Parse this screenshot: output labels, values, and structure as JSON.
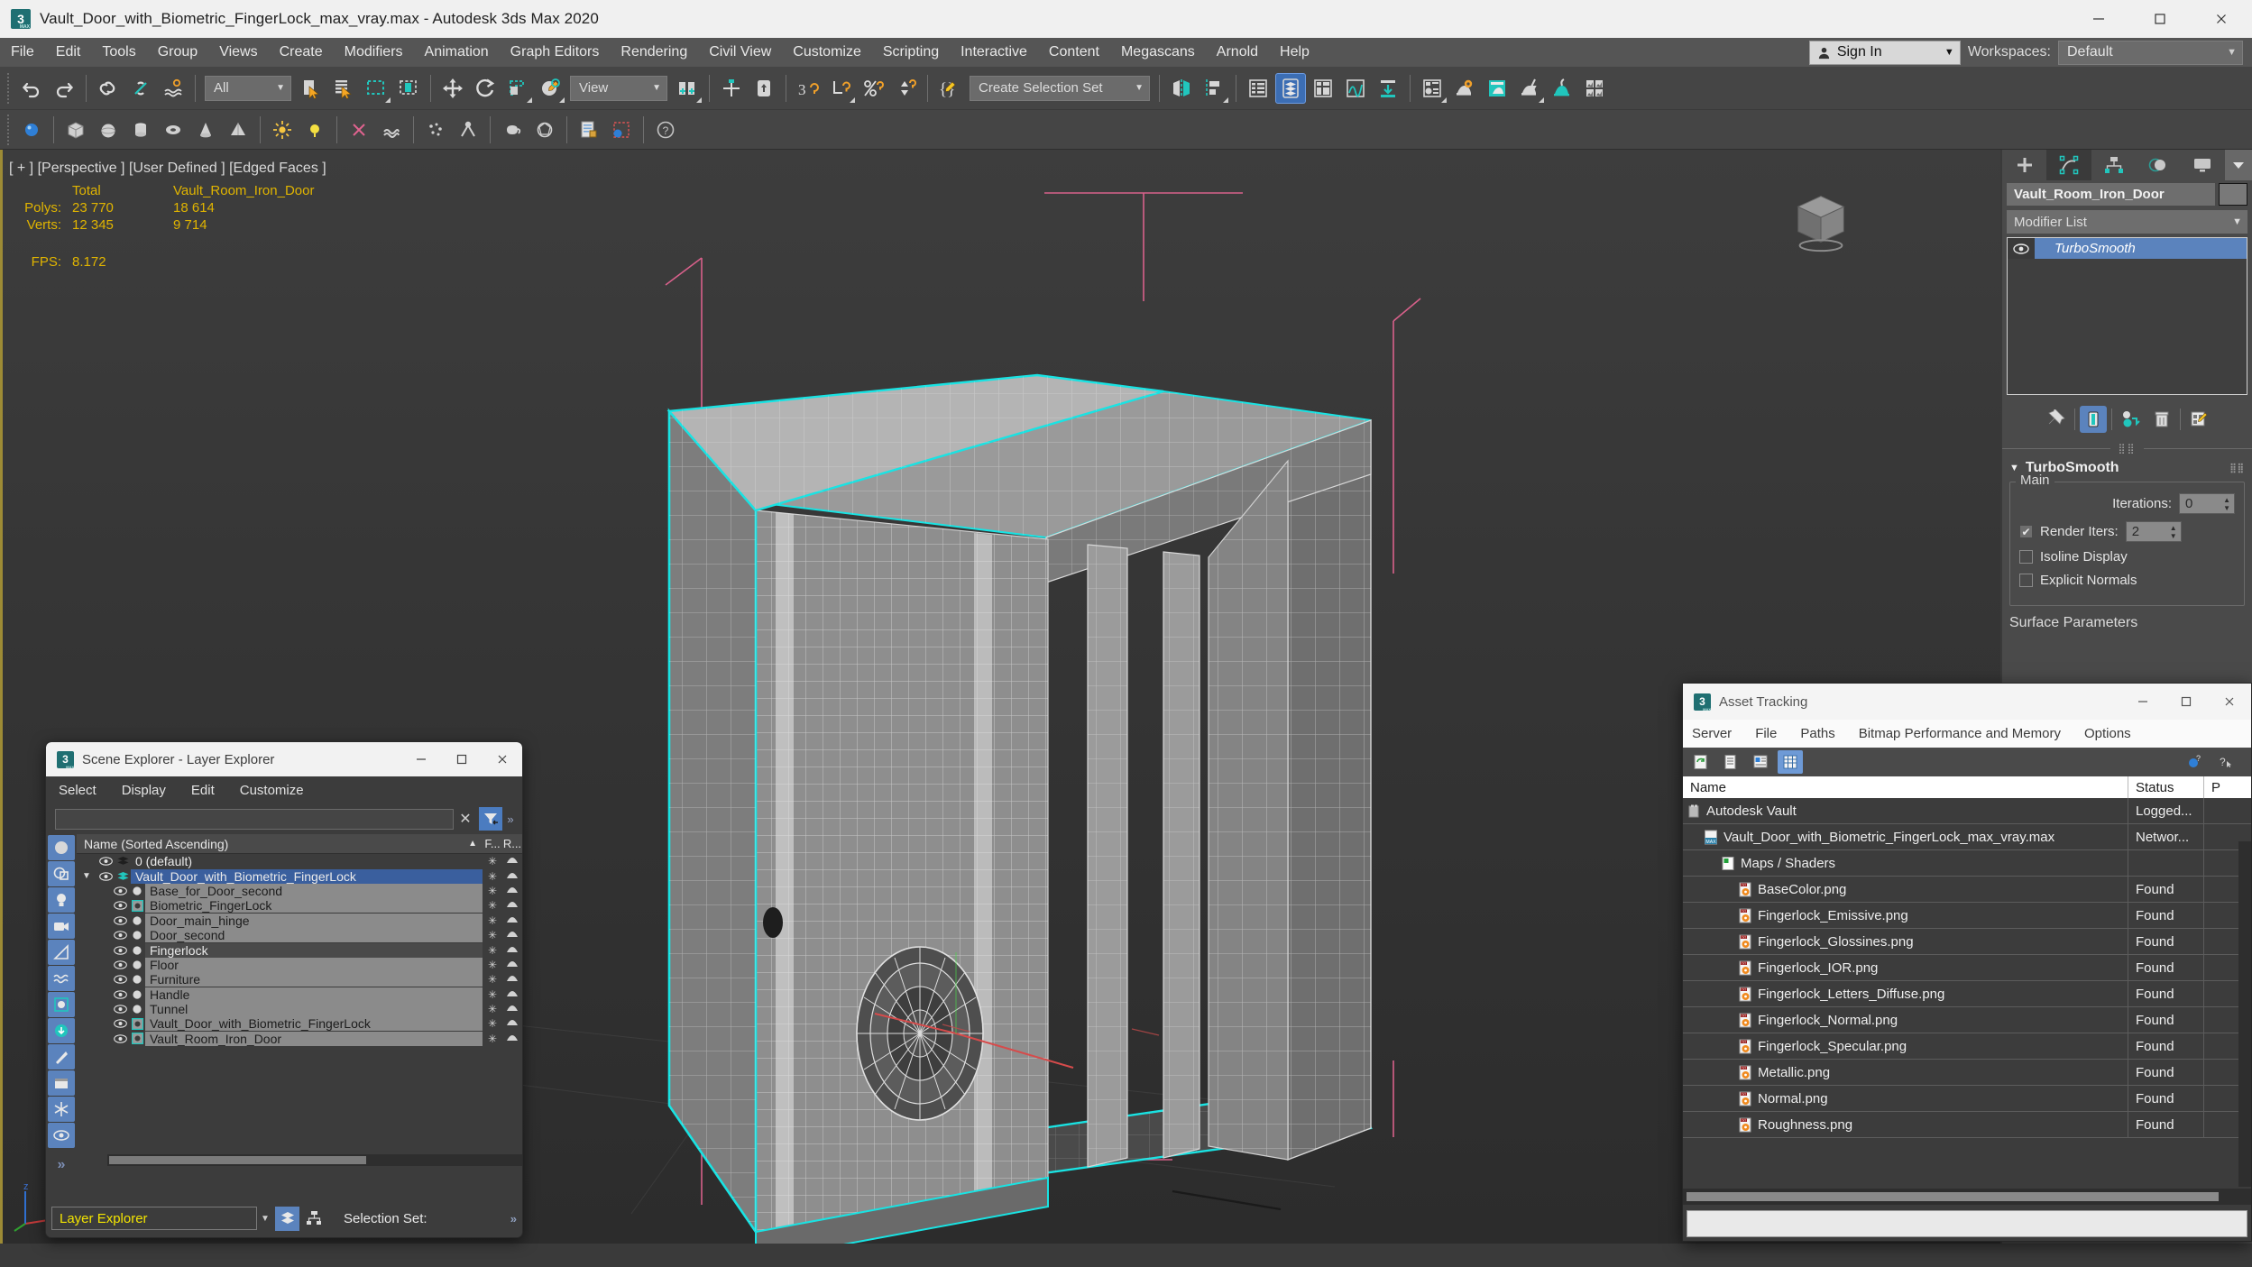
{
  "window": {
    "title": "Vault_Door_with_Biometric_FingerLock_max_vray.max - Autodesk 3ds Max 2020",
    "app_icon": "3dsmax-icon",
    "minimize": "minimize-icon",
    "maximize": "maximize-icon",
    "close": "close-icon"
  },
  "menubar": {
    "items": [
      "File",
      "Edit",
      "Tools",
      "Group",
      "Views",
      "Create",
      "Modifiers",
      "Animation",
      "Graph Editors",
      "Rendering",
      "Civil View",
      "Customize",
      "Scripting",
      "Interactive",
      "Content",
      "Megascans",
      "Arnold",
      "Help"
    ],
    "sign_in": "Sign In",
    "workspaces_label": "Workspaces:",
    "workspace_value": "Default"
  },
  "toolbar": {
    "selection_filter": "All",
    "reference_coord": "View",
    "selection_set": "Create Selection Set",
    "icons_row1": [
      "undo-icon",
      "redo-icon",
      "select-link-icon",
      "unlink-icon",
      "bind-spacewarp-icon",
      "select-object-icon",
      "select-by-name-icon",
      "rectangle-select-icon",
      "window-crossing-icon",
      "select-move-icon",
      "select-rotate-icon",
      "select-scale-icon",
      "placement-icon",
      "snap-toggle-icon",
      "angle-snap-icon",
      "percent-snap-icon",
      "spinner-snap-icon",
      "named-selection-icon",
      "mirror-icon",
      "align-icon",
      "layer-explorer-icon",
      "scene-explorer-icon",
      "ribbon-icon",
      "curve-editor-icon",
      "schematic-view-icon",
      "material-editor-icon",
      "render-setup-icon",
      "render-frame-icon",
      "render-production-icon",
      "render-iterative-icon",
      "render-in-cloud-icon"
    ],
    "icons_row2": [
      "create-icon",
      "sphere-icon",
      "box-icon",
      "cylinder-icon",
      "torus-icon",
      "cone-icon",
      "pyramid-icon",
      "light-omni-icon",
      "light-target-icon",
      "camera-icon",
      "helper-icon",
      "spacewarp-icon",
      "particle-icon",
      "systems-icon",
      "teapot-icon",
      "geosphere-icon",
      "compound-icon",
      "shapes-icon",
      "quick-render-icon",
      "asset-tracking-icon",
      "help-icon"
    ]
  },
  "viewport": {
    "label": "[ + ] [Perspective ] [User Defined ] [Edged Faces ]",
    "stats": {
      "col_total": "Total",
      "col_object": "Vault_Room_Iron_Door",
      "polys_label": "Polys:",
      "polys_total": "23 770",
      "polys_object": "18 614",
      "verts_label": "Verts:",
      "verts_total": "12 345",
      "verts_object": "9 714",
      "fps_label": "FPS:",
      "fps_value": "8.172"
    },
    "viewcube": "view-cube-icon",
    "axis_tripod": "axis-tripod-icon"
  },
  "scene_explorer": {
    "title": "Scene Explorer - Layer Explorer",
    "menu": [
      "Select",
      "Display",
      "Edit",
      "Customize"
    ],
    "search_value": "",
    "clear_icon": "clear-x-icon",
    "filter_icon": "filter-funnel-icon",
    "column_header": "Name (Sorted Ascending)",
    "col_f": "F...",
    "col_r": "R...",
    "rows": [
      {
        "name": "0 (default)",
        "indent": 1,
        "type": "layer",
        "state": "normal",
        "twirl": ""
      },
      {
        "name": "Vault_Door_with_Biometric_FingerLock",
        "indent": 1,
        "type": "layer",
        "state": "selected",
        "twirl": "▼"
      },
      {
        "name": "Base_for_Door_second",
        "indent": 2,
        "type": "object",
        "state": "shaded",
        "twirl": ""
      },
      {
        "name": "Biometric_FingerLock",
        "indent": 2,
        "type": "xref",
        "state": "shaded",
        "twirl": ""
      },
      {
        "name": "Door_main_hinge",
        "indent": 2,
        "type": "object",
        "state": "shaded",
        "twirl": ""
      },
      {
        "name": "Door_second",
        "indent": 2,
        "type": "object",
        "state": "shaded",
        "twirl": ""
      },
      {
        "name": "Fingerlock",
        "indent": 2,
        "type": "object",
        "state": "dark",
        "twirl": ""
      },
      {
        "name": "Floor",
        "indent": 2,
        "type": "object",
        "state": "shaded",
        "twirl": ""
      },
      {
        "name": "Furniture",
        "indent": 2,
        "type": "object",
        "state": "shaded",
        "twirl": ""
      },
      {
        "name": "Handle",
        "indent": 2,
        "type": "object",
        "state": "shaded",
        "twirl": ""
      },
      {
        "name": "Tunnel",
        "indent": 2,
        "type": "object",
        "state": "shaded",
        "twirl": ""
      },
      {
        "name": "Vault_Door_with_Biometric_FingerLock",
        "indent": 2,
        "type": "xref",
        "state": "shaded",
        "twirl": ""
      },
      {
        "name": "Vault_Room_Iron_Door",
        "indent": 2,
        "type": "xref",
        "state": "shaded",
        "twirl": ""
      }
    ],
    "footer_combo": "Layer Explorer",
    "selection_set_label": "Selection Set:",
    "layer_icon": "layers-stack-icon",
    "hierarchy_icon": "hierarchy-icon"
  },
  "command_panel": {
    "tabs": [
      "create-tab-icon",
      "modify-tab-icon",
      "hierarchy-tab-icon",
      "motion-tab-icon",
      "display-tab-icon",
      "utilities-tab-icon"
    ],
    "object_name": "Vault_Room_Iron_Door",
    "modifier_list": "Modifier List",
    "stack": [
      {
        "name": "TurboSmooth",
        "selected": true,
        "eye": "eye-icon"
      }
    ],
    "stack_tools": [
      "pin-stack-icon",
      "show-end-result-icon",
      "make-unique-icon",
      "remove-modifier-icon",
      "configure-sets-icon"
    ],
    "rollout": {
      "title": "TurboSmooth",
      "group_title": "Main",
      "iterations_label": "Iterations:",
      "iterations_value": "0",
      "render_iters_label": "Render Iters:",
      "render_iters_value": "2",
      "render_iters_checked": true,
      "isoline_label": "Isoline Display",
      "isoline_checked": false,
      "explicit_label": "Explicit Normals",
      "explicit_checked": false
    },
    "surface_parameters": "Surface Parameters"
  },
  "asset_tracking": {
    "title": "Asset Tracking",
    "menu": [
      "Server",
      "File",
      "Paths",
      "Bitmap Performance and Memory",
      "Options"
    ],
    "toolbar_icons": [
      "refresh-icon",
      "list-view-icon",
      "detail-view-icon",
      "grid-view-icon"
    ],
    "toolbar_right_icons": [
      "globe-help-icon",
      "help-pointer-icon"
    ],
    "columns": {
      "name": "Name",
      "status": "Status",
      "path": "P"
    },
    "rows": [
      {
        "name": "Autodesk Vault",
        "status": "Logged...",
        "indent": 1,
        "icon": "vault-icon"
      },
      {
        "name": "Vault_Door_with_Biometric_FingerLock_max_vray.max",
        "status": "Networ...",
        "indent": 2,
        "icon": "max-file-icon"
      },
      {
        "name": "Maps / Shaders",
        "status": "",
        "indent": 3,
        "icon": "maps-folder-icon"
      },
      {
        "name": "BaseColor.png",
        "status": "Found",
        "indent": 4,
        "icon": "png-icon"
      },
      {
        "name": "Fingerlock_Emissive.png",
        "status": "Found",
        "indent": 4,
        "icon": "png-icon"
      },
      {
        "name": "Fingerlock_Glossines.png",
        "status": "Found",
        "indent": 4,
        "icon": "png-icon"
      },
      {
        "name": "Fingerlock_IOR.png",
        "status": "Found",
        "indent": 4,
        "icon": "png-icon"
      },
      {
        "name": "Fingerlock_Letters_Diffuse.png",
        "status": "Found",
        "indent": 4,
        "icon": "png-icon"
      },
      {
        "name": "Fingerlock_Normal.png",
        "status": "Found",
        "indent": 4,
        "icon": "png-icon"
      },
      {
        "name": "Fingerlock_Specular.png",
        "status": "Found",
        "indent": 4,
        "icon": "png-icon"
      },
      {
        "name": "Metallic.png",
        "status": "Found",
        "indent": 4,
        "icon": "png-icon"
      },
      {
        "name": "Normal.png",
        "status": "Found",
        "indent": 4,
        "icon": "png-icon"
      },
      {
        "name": "Roughness.png",
        "status": "Found",
        "indent": 4,
        "icon": "png-icon"
      }
    ],
    "minimize": "minimize-icon",
    "maximize": "maximize-icon",
    "close": "close-icon"
  },
  "colors": {
    "accent_teal": "#1fb5ad",
    "selection_blue": "#3a5f9e",
    "highlight_blue": "#5b83bd",
    "yellow_stats": "#e0b400",
    "wireframe_cyan": "#19e3e3",
    "gizmo_pink": "#e0638f",
    "panel_bg": "#4a4a4a",
    "viewport_bg": "#383838"
  }
}
